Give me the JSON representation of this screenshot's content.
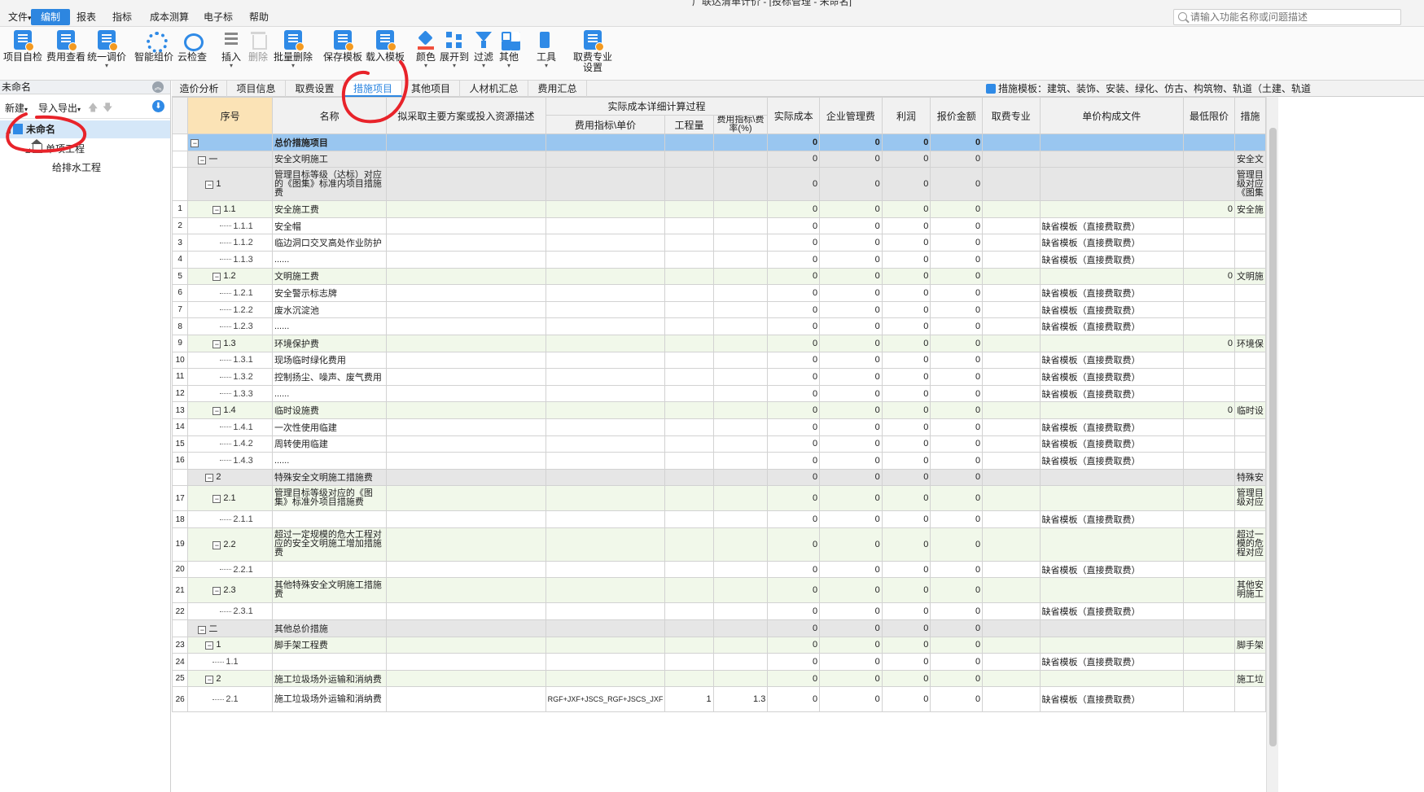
{
  "window": {
    "title": "广联达清单计价 - [投标管理 - 未命名]"
  },
  "menu": [
    {
      "label": "文件",
      "caret": "▾"
    },
    {
      "label": "编制",
      "active": true
    },
    {
      "label": "报表"
    },
    {
      "label": "指标"
    },
    {
      "label": "成本测算"
    },
    {
      "label": "电子标"
    },
    {
      "label": "帮助"
    }
  ],
  "search": {
    "placeholder": "请输入功能名称或问题描述"
  },
  "ribbon": [
    {
      "label": "项目自检",
      "icon": "doc-check-icon"
    },
    {
      "label": "费用查看",
      "icon": "doc-view-icon"
    },
    {
      "label": "统一调价",
      "icon": "price-adjust-icon",
      "dropdown": true
    },
    {
      "label": "智能组价",
      "icon": "smart-price-icon"
    },
    {
      "label": "云检查",
      "icon": "cloud-check-icon"
    },
    {
      "label": "插入",
      "icon": "insert-icon",
      "dropdown": true
    },
    {
      "label": "删除",
      "icon": "trash-icon",
      "disabled": true
    },
    {
      "label": "批量删除",
      "icon": "batch-delete-icon",
      "dropdown": true
    },
    {
      "label": "保存模板",
      "icon": "save-template-icon"
    },
    {
      "label": "载入模板",
      "icon": "load-template-icon"
    },
    {
      "label": "颜色",
      "icon": "color-bucket-icon",
      "dropdown": true
    },
    {
      "label": "展开到",
      "icon": "expand-to-icon",
      "dropdown": true
    },
    {
      "label": "过滤",
      "icon": "filter-icon",
      "dropdown": true
    },
    {
      "label": "其他",
      "icon": "more-icon",
      "dropdown": true
    },
    {
      "label": "工具",
      "icon": "tool-icon",
      "dropdown": true
    },
    {
      "label": "取费专业",
      "label2": "设置",
      "icon": "fee-setting-icon"
    }
  ],
  "left": {
    "title": "未命名",
    "tools": {
      "new": "新建",
      "import_export": "导入导出"
    },
    "tree": [
      {
        "label": "未命名",
        "level": 0,
        "selected": true
      },
      {
        "label": "单项工程",
        "level": 1
      },
      {
        "label": "给排水工程",
        "level": 2
      }
    ]
  },
  "tabs": [
    "造价分析",
    "项目信息",
    "取费设置",
    "措施项目",
    "其他项目",
    "人材机汇总",
    "费用汇总"
  ],
  "active_tab": "措施项目",
  "template_info": "措施模板：建筑、装饰、安装、绿化、仿古、构筑物、轨道（土建、轨道",
  "grid": {
    "headers": {
      "seq": "序号",
      "name": "名称",
      "plan": "拟采取主要方案或投入资源描述",
      "group": "实际成本详细计算过程",
      "index_price": "费用指标\\单价",
      "qty": "工程量",
      "rate": "费用指标\\费率(%)",
      "actual_cost": "实际成本",
      "mgmt_fee": "企业管理费",
      "profit": "利润",
      "quote": "报价金额",
      "fee_major": "取费专业",
      "unit_file": "单价构成文件",
      "min_price": "最低限价",
      "last": "措施"
    },
    "rows": [
      {
        "rn": "",
        "seq": "",
        "name": "总价措施项目",
        "lvl": "lvl0",
        "depth": 0,
        "box": "−",
        "cost": "0",
        "mgmt": "0",
        "profit": "0",
        "quote": "0",
        "file": "",
        "min": "",
        "last": ""
      },
      {
        "rn": "",
        "seq": "一",
        "name": "安全文明施工",
        "lvl": "lvl1",
        "depth": 1,
        "box": "−",
        "cost": "0",
        "mgmt": "0",
        "profit": "0",
        "quote": "0",
        "file": "",
        "min": "",
        "last": "安全文"
      },
      {
        "rn": "",
        "seq": "1",
        "name": "管理目标等级（达标）对应的《图集》标准内项目措施费",
        "lvl": "lvl2",
        "depth": 2,
        "box": "−",
        "cost": "0",
        "mgmt": "0",
        "profit": "0",
        "quote": "0",
        "file": "",
        "min": "",
        "last": "管理目级对应《图集",
        "tall": 3
      },
      {
        "rn": "1",
        "seq": "1.1",
        "name": "安全施工费",
        "lvl": "lvl3",
        "depth": 3,
        "box": "−",
        "cost": "0",
        "mgmt": "0",
        "profit": "0",
        "quote": "0",
        "file": "",
        "min": "0",
        "last": "安全施"
      },
      {
        "rn": "2",
        "seq": "1.1.1",
        "name": "安全帽",
        "lvl": "leaf",
        "depth": 4,
        "cost": "0",
        "mgmt": "0",
        "profit": "0",
        "quote": "0",
        "file": "缺省模板（直接费取费）",
        "min": "",
        "last": ""
      },
      {
        "rn": "3",
        "seq": "1.1.2",
        "name": "临边洞口交叉高处作业防护",
        "lvl": "leaf",
        "depth": 4,
        "cost": "0",
        "mgmt": "0",
        "profit": "0",
        "quote": "0",
        "file": "缺省模板（直接费取费）",
        "min": "",
        "last": ""
      },
      {
        "rn": "4",
        "seq": "1.1.3",
        "name": "......",
        "lvl": "leaf",
        "depth": 4,
        "cost": "0",
        "mgmt": "0",
        "profit": "0",
        "quote": "0",
        "file": "缺省模板（直接费取费）",
        "min": "",
        "last": ""
      },
      {
        "rn": "5",
        "seq": "1.2",
        "name": "文明施工费",
        "lvl": "lvl3",
        "depth": 3,
        "box": "−",
        "cost": "0",
        "mgmt": "0",
        "profit": "0",
        "quote": "0",
        "file": "",
        "min": "0",
        "last": "文明施"
      },
      {
        "rn": "6",
        "seq": "1.2.1",
        "name": "安全警示标志牌",
        "lvl": "leaf",
        "depth": 4,
        "cost": "0",
        "mgmt": "0",
        "profit": "0",
        "quote": "0",
        "file": "缺省模板（直接费取费）",
        "min": "",
        "last": ""
      },
      {
        "rn": "7",
        "seq": "1.2.2",
        "name": "废水沉淀池",
        "lvl": "leaf",
        "depth": 4,
        "cost": "0",
        "mgmt": "0",
        "profit": "0",
        "quote": "0",
        "file": "缺省模板（直接费取费）",
        "min": "",
        "last": ""
      },
      {
        "rn": "8",
        "seq": "1.2.3",
        "name": "......",
        "lvl": "leaf",
        "depth": 4,
        "cost": "0",
        "mgmt": "0",
        "profit": "0",
        "quote": "0",
        "file": "缺省模板（直接费取费）",
        "min": "",
        "last": ""
      },
      {
        "rn": "9",
        "seq": "1.3",
        "name": "环境保护费",
        "lvl": "lvl3",
        "depth": 3,
        "box": "−",
        "cost": "0",
        "mgmt": "0",
        "profit": "0",
        "quote": "0",
        "file": "",
        "min": "0",
        "last": "环境保"
      },
      {
        "rn": "10",
        "seq": "1.3.1",
        "name": "现场临时绿化费用",
        "lvl": "leaf",
        "depth": 4,
        "cost": "0",
        "mgmt": "0",
        "profit": "0",
        "quote": "0",
        "file": "缺省模板（直接费取费）",
        "min": "",
        "last": ""
      },
      {
        "rn": "11",
        "seq": "1.3.2",
        "name": "控制扬尘、噪声、废气费用",
        "lvl": "leaf",
        "depth": 4,
        "cost": "0",
        "mgmt": "0",
        "profit": "0",
        "quote": "0",
        "file": "缺省模板（直接费取费）",
        "min": "",
        "last": ""
      },
      {
        "rn": "12",
        "seq": "1.3.3",
        "name": "......",
        "lvl": "leaf",
        "depth": 4,
        "cost": "0",
        "mgmt": "0",
        "profit": "0",
        "quote": "0",
        "file": "缺省模板（直接费取费）",
        "min": "",
        "last": ""
      },
      {
        "rn": "13",
        "seq": "1.4",
        "name": "临时设施费",
        "lvl": "lvl3",
        "depth": 3,
        "box": "−",
        "cost": "0",
        "mgmt": "0",
        "profit": "0",
        "quote": "0",
        "file": "",
        "min": "0",
        "last": "临时设"
      },
      {
        "rn": "14",
        "seq": "1.4.1",
        "name": "一次性使用临建",
        "lvl": "leaf",
        "depth": 4,
        "cost": "0",
        "mgmt": "0",
        "profit": "0",
        "quote": "0",
        "file": "缺省模板（直接费取费）",
        "min": "",
        "last": ""
      },
      {
        "rn": "15",
        "seq": "1.4.2",
        "name": "周转使用临建",
        "lvl": "leaf",
        "depth": 4,
        "cost": "0",
        "mgmt": "0",
        "profit": "0",
        "quote": "0",
        "file": "缺省模板（直接费取费）",
        "min": "",
        "last": ""
      },
      {
        "rn": "16",
        "seq": "1.4.3",
        "name": "......",
        "lvl": "leaf",
        "depth": 4,
        "cost": "0",
        "mgmt": "0",
        "profit": "0",
        "quote": "0",
        "file": "缺省模板（直接费取费）",
        "min": "",
        "last": ""
      },
      {
        "rn": "",
        "seq": "2",
        "name": "特殊安全文明施工措施费",
        "lvl": "lvl2",
        "depth": 2,
        "box": "−",
        "cost": "0",
        "mgmt": "0",
        "profit": "0",
        "quote": "0",
        "file": "",
        "min": "",
        "last": "特殊安"
      },
      {
        "rn": "17",
        "seq": "2.1",
        "name": "管理目标等级对应的《图集》标准外项目措施费",
        "lvl": "lvl3",
        "depth": 3,
        "box": "−",
        "cost": "0",
        "mgmt": "0",
        "profit": "0",
        "quote": "0",
        "file": "",
        "min": "",
        "last": "管理目级对应",
        "tall": 2
      },
      {
        "rn": "18",
        "seq": "2.1.1",
        "name": "",
        "lvl": "leaf",
        "depth": 4,
        "cost": "0",
        "mgmt": "0",
        "profit": "0",
        "quote": "0",
        "file": "缺省模板（直接费取费）",
        "min": "",
        "last": ""
      },
      {
        "rn": "19",
        "seq": "2.2",
        "name": "超过一定规模的危大工程对应的安全文明施工增加措施费",
        "lvl": "lvl3",
        "depth": 3,
        "box": "−",
        "cost": "0",
        "mgmt": "0",
        "profit": "0",
        "quote": "0",
        "file": "",
        "min": "",
        "last": "超过一模的危程对应",
        "tall": 3
      },
      {
        "rn": "20",
        "seq": "2.2.1",
        "name": "",
        "lvl": "leaf",
        "depth": 4,
        "cost": "0",
        "mgmt": "0",
        "profit": "0",
        "quote": "0",
        "file": "缺省模板（直接费取费）",
        "min": "",
        "last": ""
      },
      {
        "rn": "21",
        "seq": "2.3",
        "name": "其他特殊安全文明施工措施费",
        "lvl": "lvl3",
        "depth": 3,
        "box": "−",
        "cost": "0",
        "mgmt": "0",
        "profit": "0",
        "quote": "0",
        "file": "",
        "min": "",
        "last": "其他安明施工",
        "tall": 2
      },
      {
        "rn": "22",
        "seq": "2.3.1",
        "name": "",
        "lvl": "leaf",
        "depth": 4,
        "cost": "0",
        "mgmt": "0",
        "profit": "0",
        "quote": "0",
        "file": "缺省模板（直接费取费）",
        "min": "",
        "last": ""
      },
      {
        "rn": "",
        "seq": "二",
        "name": "其他总价措施",
        "lvl": "lvl1",
        "depth": 1,
        "box": "−",
        "cost": "0",
        "mgmt": "0",
        "profit": "0",
        "quote": "0",
        "file": "",
        "min": "",
        "last": ""
      },
      {
        "rn": "23",
        "seq": "1",
        "name": "脚手架工程费",
        "lvl": "lvl3",
        "depth": 2,
        "box": "−",
        "cost": "0",
        "mgmt": "0",
        "profit": "0",
        "quote": "0",
        "file": "",
        "min": "",
        "last": "脚手架"
      },
      {
        "rn": "24",
        "seq": "1.1",
        "name": "",
        "lvl": "leaf",
        "depth": 3,
        "cost": "0",
        "mgmt": "0",
        "profit": "0",
        "quote": "0",
        "file": "缺省模板（直接费取费）",
        "min": "",
        "last": ""
      },
      {
        "rn": "25",
        "seq": "2",
        "name": "施工垃圾场外运输和消纳费",
        "lvl": "lvl3",
        "depth": 2,
        "box": "−",
        "cost": "0",
        "mgmt": "0",
        "profit": "0",
        "quote": "0",
        "file": "",
        "min": "",
        "last": "施工垃"
      },
      {
        "rn": "26",
        "seq": "2.1",
        "name": "施工垃圾场外运输和消纳费",
        "lvl": "leaf",
        "depth": 3,
        "index": "RGF+JXF+JSCS_RGF+JSCS_JXF",
        "qtyv": "1",
        "ratev": "1.3",
        "cost": "0",
        "mgmt": "0",
        "profit": "0",
        "quote": "0",
        "file": "缺省模板（直接费取费）",
        "min": "",
        "last": "",
        "tall": 2
      }
    ]
  },
  "colors": {
    "accent": "#2d86e0",
    "header_row": "#99c6f0",
    "annotation": "#e8232a"
  }
}
